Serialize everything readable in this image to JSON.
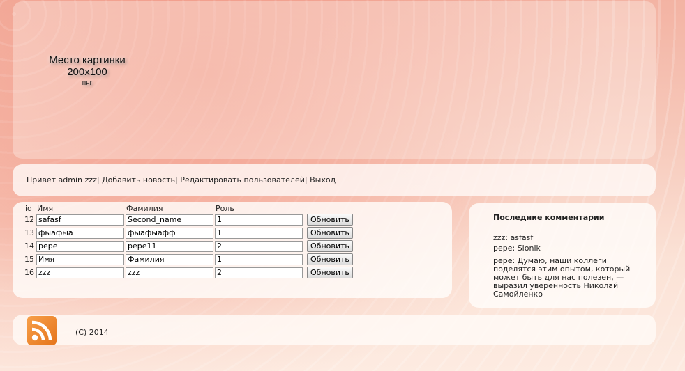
{
  "header": {
    "logo_line1": "Место картинки",
    "logo_line2": "200x100",
    "logo_line3": "пнг"
  },
  "nav": {
    "greeting": "Привет admin zzz",
    "add_news": "Добавить новость",
    "edit_users": "Редактировать пользователей",
    "logout": "Выход",
    "separator": "|"
  },
  "users_table": {
    "columns": [
      "id",
      "Имя",
      "Фамилия",
      "Роль"
    ],
    "update_label": "Обновить",
    "rows": [
      {
        "id": "12",
        "name": "safasf",
        "surname": "Second_name",
        "role": "1"
      },
      {
        "id": "13",
        "name": "фыафыа",
        "surname": "фыафыафф",
        "role": "1"
      },
      {
        "id": "14",
        "name": "pepe",
        "surname": "pepe11",
        "role": "2"
      },
      {
        "id": "15",
        "name": "Имя",
        "surname": "Фамилия",
        "role": "1"
      },
      {
        "id": "16",
        "name": "zzz",
        "surname": "zzz",
        "role": "2"
      }
    ]
  },
  "sidebar": {
    "title": "Последние комментарии",
    "comments": [
      "zzz: asfasf",
      "pepe: Slonik",
      "pepe: Думаю, наши коллеги поделятся этим опытом, который может быть для нас полезен, — выразил уверенность Николай Самойленко"
    ]
  },
  "footer": {
    "copyright": "(C) 2014",
    "rss_icon": "rss-icon",
    "rss_color": "#f08a2c"
  }
}
